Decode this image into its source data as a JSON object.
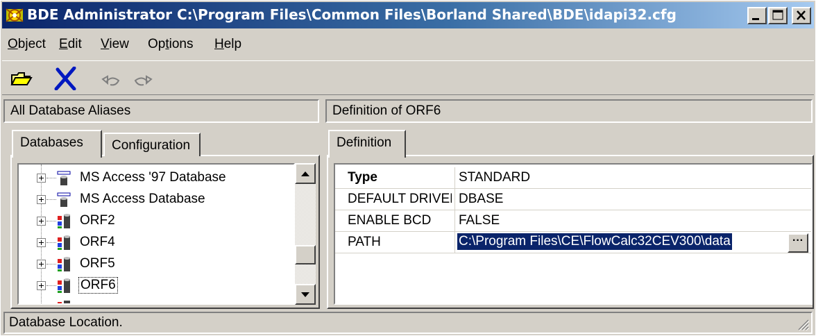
{
  "window": {
    "title": "BDE Administrator  C:\\Program Files\\Common Files\\Borland Shared\\BDE\\idapi32.cfg",
    "buttons": [
      "minimize",
      "maximize",
      "close"
    ]
  },
  "menu": [
    {
      "key": "O",
      "rest": "bject"
    },
    {
      "key": "E",
      "rest": "dit"
    },
    {
      "key": "V",
      "rest": "iew"
    },
    {
      "pre": "Op",
      "key": "t",
      "rest": "ions"
    },
    {
      "key": "H",
      "rest": "elp"
    }
  ],
  "toolbar": {
    "icons": [
      "open-folder-icon",
      "delete-x-icon",
      "undo-icon",
      "redo-icon"
    ]
  },
  "left_panel": {
    "header": "All Database Aliases",
    "tabs": [
      "Databases",
      "Configuration"
    ],
    "active_tab": "Databases",
    "tree": [
      {
        "label": "MS Access '97 Database",
        "icon": "odbc-driver-icon"
      },
      {
        "label": "MS Access Database",
        "icon": "odbc-driver-icon"
      },
      {
        "label": "ORF2",
        "icon": "standard-alias-icon"
      },
      {
        "label": "ORF4",
        "icon": "standard-alias-icon"
      },
      {
        "label": "ORF5",
        "icon": "standard-alias-icon"
      },
      {
        "label": "ORF6",
        "icon": "standard-alias-icon",
        "selected": true
      }
    ]
  },
  "right_panel": {
    "header": "Definition of ORF6",
    "tabs": [
      "Definition"
    ],
    "rows": [
      {
        "key": "Type",
        "value": "STANDARD",
        "bold": true
      },
      {
        "key": "DEFAULT DRIVER",
        "value": "DBASE"
      },
      {
        "key": "ENABLE BCD",
        "value": "FALSE"
      },
      {
        "key": "PATH",
        "value": "C:\\Program Files\\CE\\FlowCalc32CEV300\\data",
        "selected": true
      }
    ],
    "ellipsis_label": "···"
  },
  "status": "Database Location.",
  "colors": {
    "title_start": "#0a246a",
    "title_end": "#a6caf0",
    "face": "#d4d0c8",
    "selection": "#0a246a"
  }
}
